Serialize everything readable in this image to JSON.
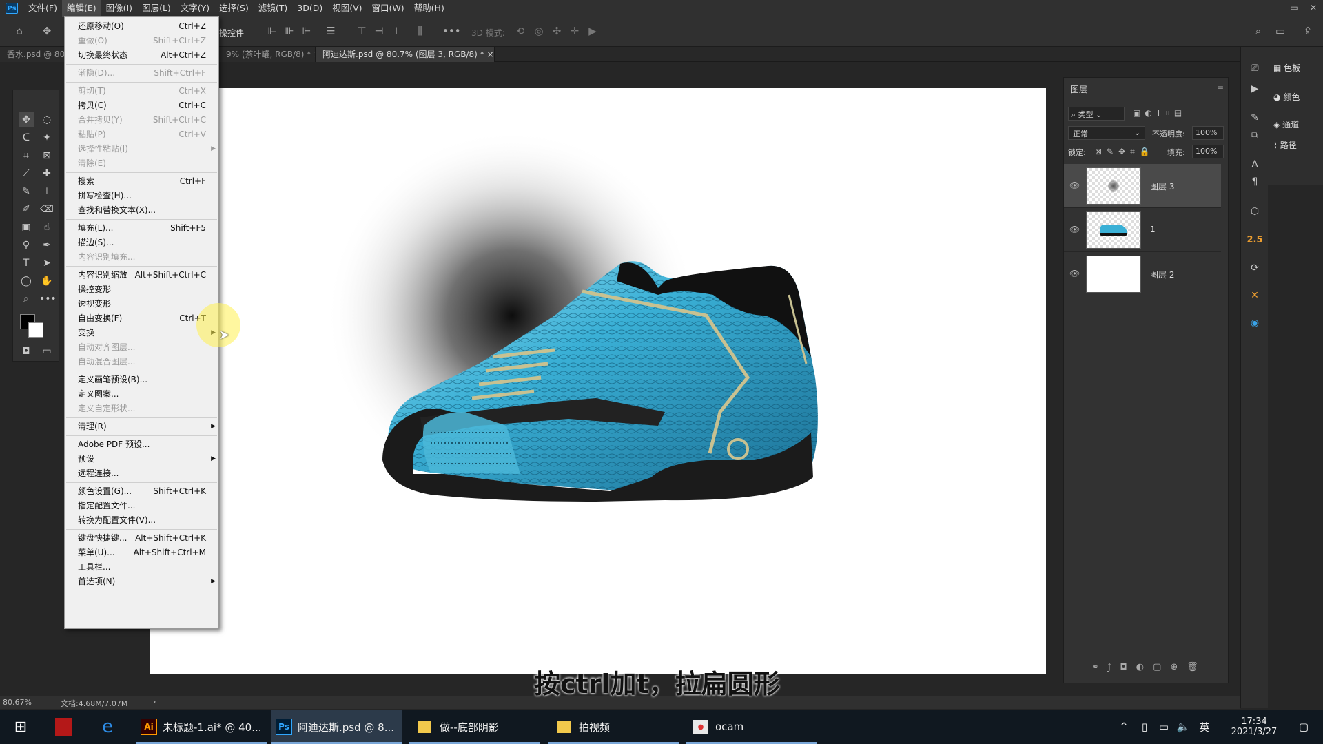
{
  "app": {
    "name": "Adobe Photoshop",
    "logo": "Ps"
  },
  "menubar": [
    "文件(F)",
    "编辑(E)",
    "图像(I)",
    "图层(L)",
    "文字(Y)",
    "选择(S)",
    "滤镜(T)",
    "3D(D)",
    "视图(V)",
    "窗口(W)",
    "帮助(H)"
  ],
  "window_controls": [
    "—",
    "▭",
    "✕"
  ],
  "options_bar": {
    "label": "操控件",
    "mode_3d": "3D 模式:"
  },
  "tabs": [
    {
      "label": "香水.psd @ 80..."
    },
    {
      "label": "9% (茶叶罐, RGB/8) *",
      "close": "×"
    },
    {
      "label": "阿迪达斯.psd @ 80.7% (图层 3, RGB/8) *",
      "close": "×"
    }
  ],
  "edit_menu": {
    "items": [
      {
        "label": "还原移动(O)",
        "key": "Ctrl+Z",
        "enabled": true
      },
      {
        "label": "重做(O)",
        "key": "Shift+Ctrl+Z",
        "enabled": false
      },
      {
        "label": "切换最终状态",
        "key": "Alt+Ctrl+Z",
        "enabled": true
      },
      {
        "label": "渐隐(D)...",
        "key": "Shift+Ctrl+F",
        "enabled": false
      },
      {
        "label": "剪切(T)",
        "key": "Ctrl+X",
        "enabled": false
      },
      {
        "label": "拷贝(C)",
        "key": "Ctrl+C",
        "enabled": true
      },
      {
        "label": "合并拷贝(Y)",
        "key": "Shift+Ctrl+C",
        "enabled": false
      },
      {
        "label": "粘贴(P)",
        "key": "Ctrl+V",
        "enabled": false
      },
      {
        "label": "选择性粘贴(I)",
        "key": "",
        "enabled": false,
        "submenu": true
      },
      {
        "label": "清除(E)",
        "key": "",
        "enabled": false
      },
      {
        "label": "搜索",
        "key": "Ctrl+F",
        "enabled": true
      },
      {
        "label": "拼写检查(H)...",
        "key": "",
        "enabled": true
      },
      {
        "label": "查找和替换文本(X)...",
        "key": "",
        "enabled": true
      },
      {
        "label": "填充(L)...",
        "key": "Shift+F5",
        "enabled": true
      },
      {
        "label": "描边(S)...",
        "key": "",
        "enabled": true
      },
      {
        "label": "内容识别填充...",
        "key": "",
        "enabled": false
      },
      {
        "label": "内容识别缩放",
        "key": "Alt+Shift+Ctrl+C",
        "enabled": true
      },
      {
        "label": "操控变形",
        "key": "",
        "enabled": true
      },
      {
        "label": "透视变形",
        "key": "",
        "enabled": true
      },
      {
        "label": "自由变换(F)",
        "key": "Ctrl+T",
        "enabled": true
      },
      {
        "label": "变换",
        "key": "",
        "enabled": true,
        "submenu": true
      },
      {
        "label": "自动对齐图层...",
        "key": "",
        "enabled": false
      },
      {
        "label": "自动混合图层...",
        "key": "",
        "enabled": false
      },
      {
        "label": "定义画笔预设(B)...",
        "key": "",
        "enabled": true
      },
      {
        "label": "定义图案...",
        "key": "",
        "enabled": true
      },
      {
        "label": "定义自定形状...",
        "key": "",
        "enabled": false
      },
      {
        "label": "清理(R)",
        "key": "",
        "enabled": true,
        "submenu": true
      },
      {
        "label": "Adobe PDF 预设...",
        "key": "",
        "enabled": true
      },
      {
        "label": "预设",
        "key": "",
        "enabled": true,
        "submenu": true
      },
      {
        "label": "远程连接...",
        "key": "",
        "enabled": true
      },
      {
        "label": "颜色设置(G)...",
        "key": "Shift+Ctrl+K",
        "enabled": true
      },
      {
        "label": "指定配置文件...",
        "key": "",
        "enabled": true
      },
      {
        "label": "转换为配置文件(V)...",
        "key": "",
        "enabled": true
      },
      {
        "label": "键盘快捷键...",
        "key": "Alt+Shift+Ctrl+K",
        "enabled": true
      },
      {
        "label": "菜单(U)...",
        "key": "Alt+Shift+Ctrl+M",
        "enabled": true
      },
      {
        "label": "工具栏...",
        "key": "",
        "enabled": true
      },
      {
        "label": "首选项(N)",
        "key": "",
        "enabled": true,
        "submenu": true
      }
    ]
  },
  "layers_panel": {
    "title": "图层",
    "filter": "类型",
    "blend_mode": "正常",
    "opacity_label": "不透明度:",
    "opacity": "100%",
    "lock_label": "锁定:",
    "fill_label": "填充:",
    "fill": "100%",
    "layers": [
      {
        "name": "图层 3",
        "selected": true
      },
      {
        "name": "1",
        "selected": false
      },
      {
        "name": "图层 2",
        "selected": false
      }
    ]
  },
  "right_panels": [
    {
      "label": "色板",
      "icon": "grid-icon"
    },
    {
      "label": "颜色",
      "icon": "palette-icon"
    },
    {
      "label": "通道",
      "icon": "channels-icon"
    },
    {
      "label": "路径",
      "icon": "paths-icon"
    }
  ],
  "right_strip_badge": "2.5",
  "status": {
    "zoom": "80.67%",
    "doc": "文档:4.68M/7.07M"
  },
  "subtitle": "按ctrl加t，拉扁圆形",
  "taskbar": {
    "apps": [
      {
        "label": "未标题-1.ai* @ 40...",
        "icon": "Ai"
      },
      {
        "label": "阿迪达斯.psd @ 8...",
        "icon": "Ps",
        "active": true
      },
      {
        "label": "做--底部阴影",
        "icon": "folder"
      },
      {
        "label": "拍视频",
        "icon": "folder"
      },
      {
        "label": "ocam",
        "icon": "ocam"
      }
    ],
    "tray_lang": "英",
    "time": "17:34",
    "date": "2021/3/27"
  },
  "colors": {
    "ps_blue": "#31a8ff",
    "panel": "#323232",
    "shoe_blue": "#3ab0d6"
  }
}
